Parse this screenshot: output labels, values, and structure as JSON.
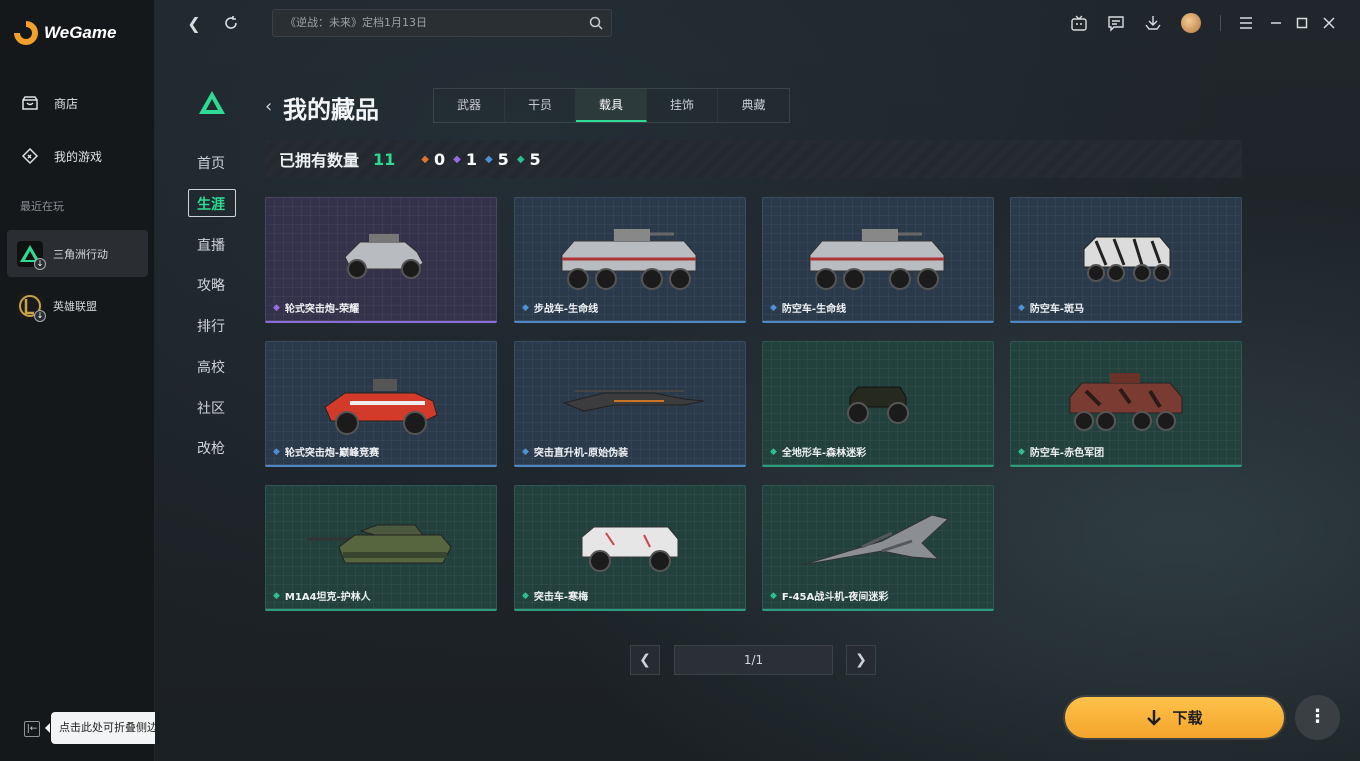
{
  "app": {
    "logo_text": "WeGame"
  },
  "sidebar": {
    "nav": [
      {
        "label": "商店",
        "icon": "store-icon"
      },
      {
        "label": "我的游戏",
        "icon": "gamepad-icon"
      }
    ],
    "recent_label": "最近在玩",
    "games": [
      {
        "label": "三角洲行动",
        "icon": "delta-force-icon",
        "active": true
      },
      {
        "label": "英雄联盟",
        "icon": "lol-icon",
        "active": false
      }
    ],
    "collapse_tooltip": "点击此处可折叠侧边栏"
  },
  "topbar": {
    "search_placeholder": "《逆战：未来》定档1月13日"
  },
  "game_nav": {
    "items": [
      "首页",
      "生涯",
      "直播",
      "攻略",
      "排行",
      "高校",
      "社区",
      "改枪"
    ],
    "active_index": 1
  },
  "collection": {
    "title": "我的藏品",
    "tabs": [
      "武器",
      "干员",
      "载具",
      "挂饰",
      "典藏"
    ],
    "active_tab": 2,
    "owned_label": "已拥有数量",
    "owned_count": "11",
    "rarity_counts": [
      {
        "icon": "orange-diamond-icon",
        "color": "#e0742c",
        "value": "0"
      },
      {
        "icon": "purple-diamond-icon",
        "color": "#9b6be6",
        "value": "1"
      },
      {
        "icon": "blue-diamond-icon",
        "color": "#4f8fd6",
        "value": "5"
      },
      {
        "icon": "green-diamond-icon",
        "color": "#2ebf8f",
        "value": "5"
      }
    ],
    "items": [
      {
        "name": "轮式突击炮-荣耀",
        "rarity": "purple",
        "vehicle": "buggy"
      },
      {
        "name": "步战车-生命线",
        "rarity": "blue",
        "vehicle": "apc"
      },
      {
        "name": "防空车-生命线",
        "rarity": "blue",
        "vehicle": "apc"
      },
      {
        "name": "防空车-斑马",
        "rarity": "blue",
        "vehicle": "apc-zebra"
      },
      {
        "name": "轮式突击炮-巅峰竞赛",
        "rarity": "blue",
        "vehicle": "buggy-red"
      },
      {
        "name": "突击直升机-原始伪装",
        "rarity": "blue",
        "vehicle": "heli"
      },
      {
        "name": "全地形车-森林迷彩",
        "rarity": "teal",
        "vehicle": "atv"
      },
      {
        "name": "防空车-赤色军团",
        "rarity": "teal",
        "vehicle": "apc-red"
      },
      {
        "name": "M1A4坦克-护林人",
        "rarity": "teal",
        "vehicle": "tank"
      },
      {
        "name": "突击车-寒梅",
        "rarity": "teal",
        "vehicle": "truck"
      },
      {
        "name": "F-45A战斗机-夜间迷彩",
        "rarity": "teal",
        "vehicle": "jet"
      }
    ]
  },
  "pagination": {
    "display": "1/1"
  },
  "actions": {
    "download_label": "下载"
  }
}
